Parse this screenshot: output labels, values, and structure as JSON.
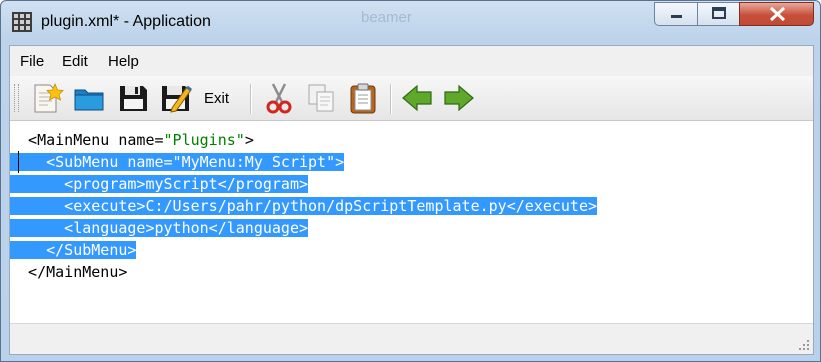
{
  "window": {
    "title": "plugin.xml* - Application",
    "background_text": "beamer"
  },
  "menu": {
    "items": [
      {
        "label": "File"
      },
      {
        "label": "Edit"
      },
      {
        "label": "Help"
      }
    ]
  },
  "toolbar": {
    "buttons": [
      {
        "icon": "new-file-icon"
      },
      {
        "icon": "open-folder-icon"
      },
      {
        "icon": "save-icon"
      },
      {
        "icon": "save-as-icon"
      },
      {
        "label": "Exit"
      },
      {
        "icon": "cut-icon"
      },
      {
        "icon": "copy-icon"
      },
      {
        "icon": "paste-icon"
      },
      {
        "icon": "back-arrow-icon"
      },
      {
        "icon": "forward-arrow-icon"
      }
    ]
  },
  "editor": {
    "lines": [
      {
        "pre": "  <MainMenu name=",
        "str": "\"Plugins\"",
        "post": ">",
        "selected": false
      },
      {
        "pre": "    <SubMenu name=\"MyMenu:My Script\">",
        "str": "",
        "post": "",
        "selected": true
      },
      {
        "pre": "      <program>myScript</program>",
        "str": "",
        "post": "",
        "selected": true
      },
      {
        "pre": "      <execute>C:/Users/pahr/python/dpScriptTemplate.py</execute>",
        "str": "",
        "post": "",
        "selected": true
      },
      {
        "pre": "      <language>python</language>",
        "str": "",
        "post": "",
        "selected": true
      },
      {
        "pre": "    </SubMenu>",
        "str": "",
        "post": "",
        "selected": true
      },
      {
        "pre": "  </MainMenu>",
        "str": "",
        "post": "",
        "selected": false
      }
    ],
    "selection_color": "#3399ff",
    "string_color": "#008000"
  }
}
